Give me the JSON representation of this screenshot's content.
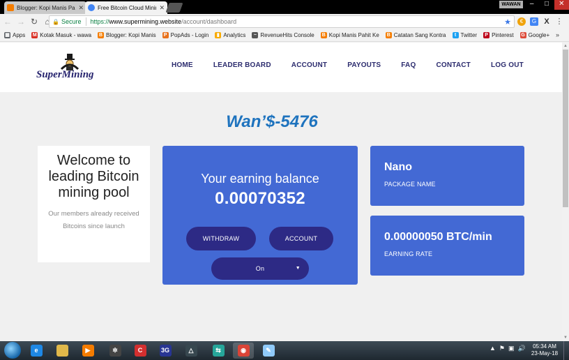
{
  "browser": {
    "tabs": [
      {
        "title": "Blogger: Kopi Manis Pahit",
        "state": "inactive",
        "favicon_color": "#f57d00"
      },
      {
        "title": "Free Bitcoin Cloud Mining",
        "state": "active",
        "favicon_color": "#4285f4"
      }
    ],
    "profile_name": "WAWAN",
    "window_controls": {
      "minimize": "–",
      "maximize": "□",
      "close": "✕"
    },
    "omnibox": {
      "secure_label": "Secure",
      "url_scheme": "https://",
      "url_host": "www.supermining.website",
      "url_path": "/account/dashboard"
    },
    "bookmarks": [
      {
        "label": "Apps",
        "icon": "apps-grid-icon",
        "color": "#5f6368"
      },
      {
        "label": "Kotak Masuk - wawa",
        "icon": "gmail-icon",
        "color": "#d93025"
      },
      {
        "label": "Blogger: Kopi Manis",
        "icon": "blogger-icon",
        "color": "#f57d00"
      },
      {
        "label": "PopAds - Login",
        "icon": "popads-icon",
        "color": "#e8711c"
      },
      {
        "label": "Analytics",
        "icon": "analytics-icon",
        "color": "#f9ab00"
      },
      {
        "label": "RevenueHits Console",
        "icon": "revenuehits-icon",
        "color": "#555555"
      },
      {
        "label": "Kopi Manis Pahit Ke",
        "icon": "blogger-icon",
        "color": "#f57d00"
      },
      {
        "label": "Catatan Sang Kontra",
        "icon": "blogger-icon",
        "color": "#f57d00"
      },
      {
        "label": "Twitter",
        "icon": "twitter-icon",
        "color": "#1da1f2"
      },
      {
        "label": "Pinterest",
        "icon": "pinterest-icon",
        "color": "#bd081c"
      },
      {
        "label": "Google+",
        "icon": "googleplus-icon",
        "color": "#dd4b39"
      }
    ],
    "bookmarks_more": "»"
  },
  "site": {
    "logo_text": "SuperMining",
    "nav": [
      "HOME",
      "LEADER BOARD",
      "ACCOUNT",
      "PAYOUTS",
      "FAQ",
      "CONTACT",
      "LOG OUT"
    ],
    "username": "Wan’$-5476",
    "welcome": {
      "title": "Welcome to leading Bitcoin mining pool",
      "subtitle": "Our members already received Bitcoins since launch"
    },
    "balance": {
      "label": "Your earning balance",
      "value": "0.00070352",
      "withdraw_label": "WITHDRAW",
      "account_label": "ACCOUNT",
      "mining_state": "On"
    },
    "package": {
      "value": "Nano",
      "label": "PACKAGE NAME"
    },
    "rate": {
      "value": "0.00000050 BTC/min",
      "label": "EARNING RATE"
    },
    "colors": {
      "card_blue": "#4369d4",
      "pill_navy": "#2d2a85",
      "username_blue": "#1e73be",
      "nav_text": "#2c2c6e"
    }
  },
  "taskbar": {
    "apps": [
      {
        "name": "internet-explorer",
        "icon": "ie-icon",
        "color": "#1e88e5",
        "glyph": "e"
      },
      {
        "name": "file-explorer",
        "icon": "folder-icon",
        "color": "#e0b84a",
        "glyph": ""
      },
      {
        "name": "media-player",
        "icon": "media-player-icon",
        "color": "#f57c00",
        "glyph": "▶"
      },
      {
        "name": "app-wheel",
        "icon": "wheel-icon",
        "color": "#444444",
        "glyph": "✲"
      },
      {
        "name": "ccleaner",
        "icon": "ccleaner-icon",
        "color": "#d32f2f",
        "glyph": "C"
      },
      {
        "name": "3g-modem",
        "icon": "modem-3g-icon",
        "color": "#283593",
        "glyph": "3G"
      },
      {
        "name": "drawing-app",
        "icon": "compass-icon",
        "color": "#37474f",
        "glyph": "△"
      },
      {
        "name": "transfer-app",
        "icon": "transfer-icon",
        "color": "#26a69a",
        "glyph": "⇆"
      },
      {
        "name": "chrome",
        "icon": "chrome-icon",
        "color": "#db4437",
        "glyph": "◉"
      },
      {
        "name": "notepad",
        "icon": "notepad-icon",
        "color": "#90caf9",
        "glyph": "✎"
      }
    ],
    "time": "05:34 AM",
    "date": "23-May-18"
  }
}
